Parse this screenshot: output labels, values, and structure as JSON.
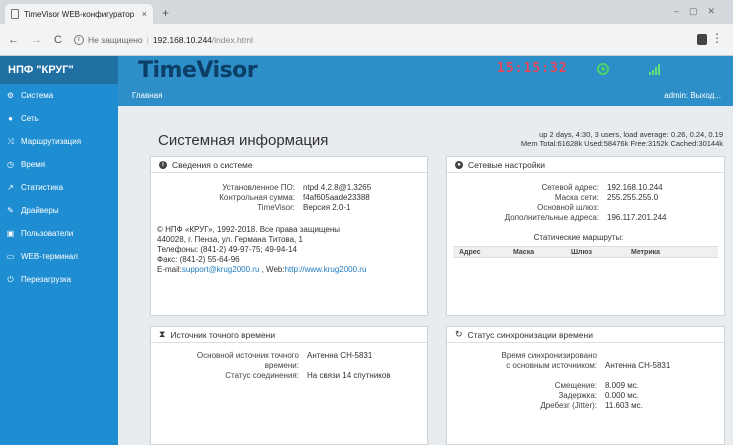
{
  "browser": {
    "tab_title": "TimeVisor WEB-конфигуратор",
    "tab_close": "×",
    "new_tab": "+",
    "nav_back": "←",
    "nav_forward": "→",
    "nav_reload": "C",
    "insecure_label": "Не защищено",
    "url_host": "192.168.10.244",
    "url_path": "/index.html",
    "menu": "⋮"
  },
  "header": {
    "brand": "НПФ \"КРУГ\"",
    "logo": "TimeVisor",
    "clock": "15:15:32"
  },
  "sidebar": {
    "items": [
      {
        "icon": "⚙",
        "label": "Система"
      },
      {
        "icon": "●",
        "label": "Сеть"
      },
      {
        "icon": "⤨",
        "label": "Маршрутизация"
      },
      {
        "icon": "◷",
        "label": "Время"
      },
      {
        "icon": "↗",
        "label": "Статистика"
      },
      {
        "icon": "✎",
        "label": "Драйверы"
      },
      {
        "icon": "▣",
        "label": "Пользователи"
      },
      {
        "icon": "▭",
        "label": "WEB-терминал"
      },
      {
        "icon": "⏻",
        "label": "Перезагрузка"
      }
    ]
  },
  "crumb": {
    "home": "Главная",
    "user": "admin:",
    "logout": "Выход..."
  },
  "main": {
    "title": "Системная информация",
    "stat_line1": "up 2 days, 4:30, 3 users, load average: 0.26, 0.24, 0.19",
    "stat_line2": "Mem Total:61628k Used:58476k Free:3152k Cached:30144k"
  },
  "panel_system": {
    "title": "Сведения о системе",
    "icon": "i",
    "rows": [
      {
        "k": "Установленное ПО:",
        "v": "ntpd 4.2.8@1.3265"
      },
      {
        "k": "Контрольная сумма:",
        "v": "f4af605aade23388"
      },
      {
        "k": "TimeVisor:",
        "v": "Версия 2.0-1"
      }
    ],
    "about": {
      "line1": "© НПФ «КРУГ», 1992-2018. Все права защищены",
      "line2": "440028, г. Пенза, ул. Германа Титова, 1",
      "line3": "Телефоны: (841-2) 49-97-75; 49-94-14",
      "line4": "Факс: (841-2) 55-64-96",
      "email_prefix": "E-mail:",
      "email": "support@krug2000.ru",
      "web_prefix": " , Web:",
      "web": "http://www.krug2000.ru"
    }
  },
  "panel_network": {
    "title": "Сетевые настройки",
    "icon": "●",
    "rows": [
      {
        "k": "Сетевой адрес:",
        "v": "192.168.10.244"
      },
      {
        "k": "Маска сети:",
        "v": "255.255.255.0"
      },
      {
        "k": "Основной шлюз:",
        "v": ""
      },
      {
        "k": "Дополнительные адреса:",
        "v": "196.117.201.244"
      }
    ],
    "routes_label": "Статические маршруты:",
    "routes_columns": [
      "Адрес",
      "Маска",
      "Шлюз",
      "Метрика"
    ]
  },
  "panel_source": {
    "title": "Источник точного времени",
    "icon": "⧗",
    "rows": [
      {
        "k": "Основной источник точного времени:",
        "v": "Антенна CH-5831"
      },
      {
        "k": "Статус соединения:",
        "v": "На связи 14 спутников"
      }
    ]
  },
  "panel_sync": {
    "title": "Статус синхронизации времени",
    "icon": "↻",
    "sync_label": "Время синхронизировано с основным источником:",
    "sync_value": "Антенна CH-5831",
    "rows": [
      {
        "k": "Смещение:",
        "v": "8.009 мс."
      },
      {
        "k": "Задержка:",
        "v": "0.000 мс."
      },
      {
        "k": "Дребезг (Jitter):",
        "v": "11.603 мс."
      }
    ]
  }
}
